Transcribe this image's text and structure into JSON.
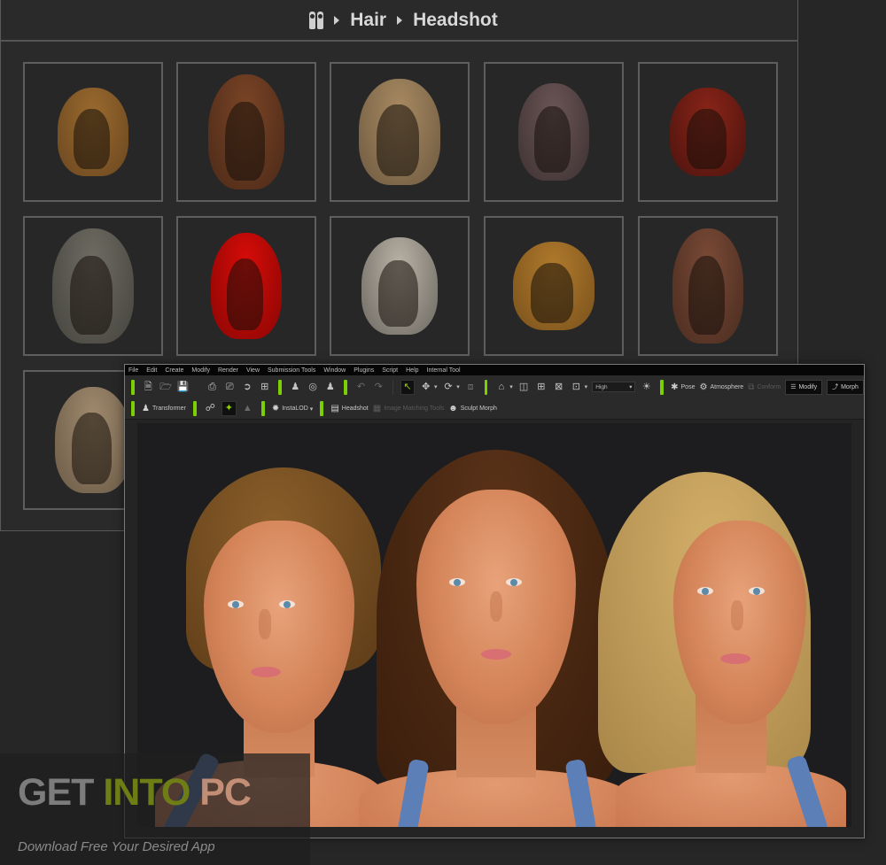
{
  "breadcrumb": {
    "root_icon": "figures-icon",
    "items": [
      "Hair",
      "Headshot"
    ]
  },
  "hair_library": {
    "items": [
      {
        "name": "long-wavy-blonde",
        "color": "#9a6a2e",
        "shade": "#6b4720"
      },
      {
        "name": "short-curly-auburn",
        "color": "#7a4426",
        "shade": "#4c2a18"
      },
      {
        "name": "long-straight-blonde",
        "color": "#a88a62",
        "shade": "#6e5a40"
      },
      {
        "name": "short-ash-brown",
        "color": "#6b5556",
        "shade": "#3e3233"
      },
      {
        "name": "bob-dark-red",
        "color": "#8a2418",
        "shade": "#4c140e"
      },
      {
        "name": "long-gray-hood",
        "color": "#6e6c62",
        "shade": "#45443e"
      },
      {
        "name": "long-bright-red",
        "color": "#d80c08",
        "shade": "#8a0604"
      },
      {
        "name": "short-platinum",
        "color": "#b9b2a6",
        "shade": "#6e6a62"
      },
      {
        "name": "wavy-golden",
        "color": "#b07a2c",
        "shade": "#7a521c"
      },
      {
        "name": "long-chestnut",
        "color": "#7a4a36",
        "shade": "#4a2c20"
      },
      {
        "name": "bob-light-blonde",
        "color": "#a08a6e",
        "shade": "#6a5a46"
      }
    ]
  },
  "app": {
    "menu": [
      "File",
      "Edit",
      "Create",
      "Modify",
      "Render",
      "View",
      "Submission Tools",
      "Window",
      "Plugins",
      "Script",
      "Help",
      "Internal Tool"
    ],
    "toolbar": {
      "quality_select": "High",
      "pose_label": "Pose",
      "atmosphere_label": "Atmosphere",
      "conform_label": "Conform",
      "modify_label": "Modify",
      "morph_label": "Morph"
    },
    "toolbar2": {
      "transformer_label": "Transformer",
      "instalod_label": "InstaLOD",
      "headshot_label": "Headshot",
      "image_matching_label": "Image Matching Tools",
      "sculpt_morph_label": "Sculpt Morph"
    },
    "colors": {
      "accent": "#7ad000",
      "viewport_bg": "#1d1d1f"
    }
  },
  "viewport": {
    "characters": [
      {
        "name": "character-left",
        "hair_color": "#7a5224"
      },
      {
        "name": "character-center",
        "hair_color": "#4a2814"
      },
      {
        "name": "character-right",
        "hair_color": "#c9a15c"
      }
    ]
  },
  "watermark": {
    "get": "GET ",
    "into": "INTO",
    "pc": " PC",
    "subtitle": "Download Free Your Desired App"
  }
}
